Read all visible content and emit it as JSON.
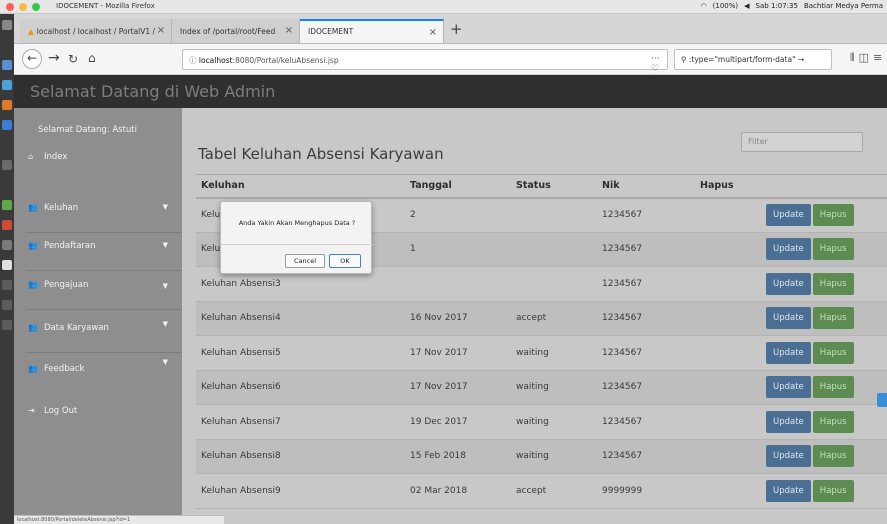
{
  "os": {
    "window_title": "IDOCEMENT - Mozilla Firefox",
    "status_items": [
      "(100%)",
      "Sab 1:07:35",
      "Bachtiar Medya Perma"
    ]
  },
  "browser": {
    "tabs": [
      {
        "label": "localhost / localhost / PortalV1 / ",
        "active": false
      },
      {
        "label": "Index of /portal/root/Feed",
        "active": false
      },
      {
        "label": "IDOCEMENT",
        "active": true
      }
    ],
    "url_prefix": "localhost",
    "url": ":8080/Portal/keluAbsensi.jsp",
    "search_text": ":type=\"multipart/form-data\"",
    "status_url": "localhost:8080/Portal/deleteAbsensi.jsp?id=1"
  },
  "site": {
    "title": "Selamat Datang di Web Admin"
  },
  "sidebar": {
    "greeting": "Selamat Datang: Astuti",
    "items": [
      {
        "label": "Index",
        "icon": "home-icon",
        "has_caret": false
      },
      {
        "label": "Keluhan",
        "icon": "users-icon",
        "has_caret": true
      },
      {
        "label": "Pendaftaran",
        "icon": "users-icon",
        "has_caret": true
      },
      {
        "label": "Pengajuan",
        "icon": "users-icon",
        "has_caret": true
      },
      {
        "label": "Data Karyawan",
        "icon": "users-icon",
        "has_caret": true
      },
      {
        "label": "Feedback",
        "icon": "users-icon",
        "has_caret": true
      },
      {
        "label": "Log Out",
        "icon": "logout-icon",
        "has_caret": false
      }
    ]
  },
  "main": {
    "title": "Tabel Keluhan Absensi Karyawan",
    "filter_placeholder": "Filter",
    "columns": [
      "Keluhan",
      "Tanggal",
      "Status",
      "Nik",
      "Hapus"
    ],
    "update_label": "Update",
    "delete_label": "Hapus",
    "rows": [
      {
        "keluhan": "Keluhan Absensi",
        "tanggal": "2",
        "status": "",
        "nik": "1234567"
      },
      {
        "keluhan": "Keluhan Absensi2",
        "tanggal": "1",
        "status": "",
        "nik": "1234567"
      },
      {
        "keluhan": "Keluhan Absensi3",
        "tanggal": "",
        "status": "",
        "nik": "1234567"
      },
      {
        "keluhan": "Keluhan Absensi4",
        "tanggal": "16 Nov 2017",
        "status": "accept",
        "nik": "1234567"
      },
      {
        "keluhan": "Keluhan Absensi5",
        "tanggal": "17 Nov 2017",
        "status": "waiting",
        "nik": "1234567"
      },
      {
        "keluhan": "Keluhan Absensi6",
        "tanggal": "17 Nov 2017",
        "status": "waiting",
        "nik": "1234567"
      },
      {
        "keluhan": "Keluhan Absensi7",
        "tanggal": "19 Dec 2017",
        "status": "waiting",
        "nik": "1234567"
      },
      {
        "keluhan": "Keluhan Absensi8",
        "tanggal": "15 Feb 2018",
        "status": "waiting",
        "nik": "1234567"
      },
      {
        "keluhan": "Keluhan Absensi9",
        "tanggal": "02 Mar 2018",
        "status": "accept",
        "nik": "9999999"
      }
    ]
  },
  "dialog": {
    "message": "Anda Yakin Akan Menghapus Data ?",
    "cancel_label": "Cancel",
    "ok_label": "OK"
  }
}
